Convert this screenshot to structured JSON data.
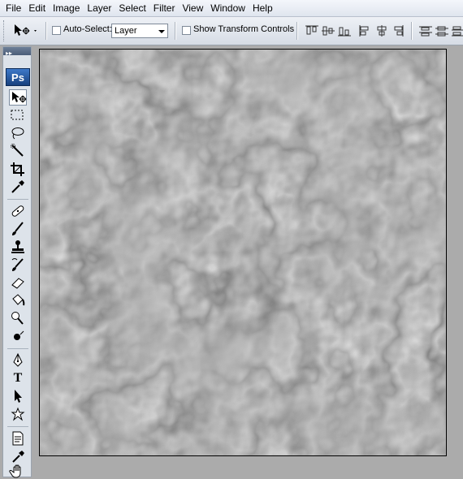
{
  "menu": [
    "File",
    "Edit",
    "Image",
    "Layer",
    "Select",
    "Filter",
    "View",
    "Window",
    "Help"
  ],
  "options": {
    "auto_select_label": "Auto-Select:",
    "auto_select_value": "Layer",
    "show_transform_label": "Show Transform Controls"
  },
  "toolbox": {
    "logo": "Ps",
    "text_tool_glyph": "T"
  },
  "canvas": {
    "description_icon": "chrome-liquid-texture"
  }
}
